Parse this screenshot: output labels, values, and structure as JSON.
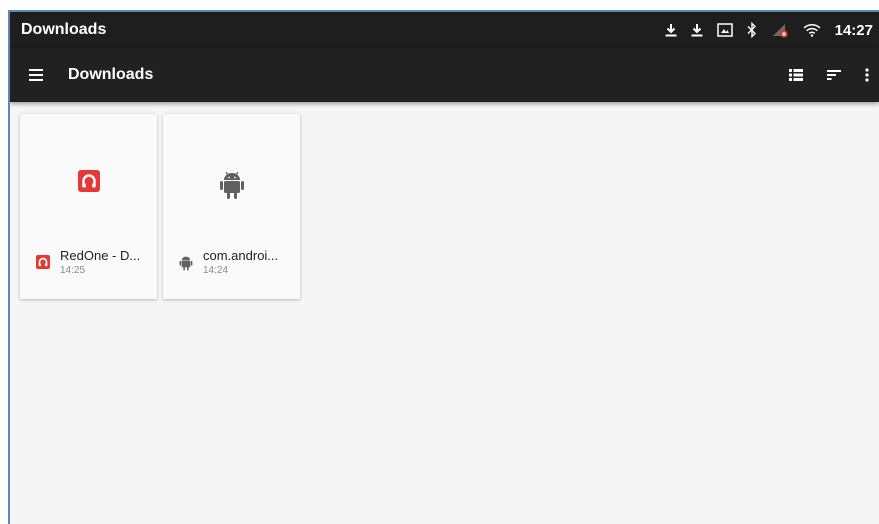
{
  "status_bar": {
    "title": "Downloads",
    "time": "14:27",
    "icons": [
      "download-icon",
      "download-icon",
      "screenshot-icon",
      "bluetooth-icon",
      "network-error-icon",
      "wifi-icon"
    ]
  },
  "toolbar": {
    "title": "Downloads",
    "menu_icon": "hamburger-menu-icon",
    "actions": [
      "list-view-icon",
      "sort-icon",
      "more-options-icon"
    ]
  },
  "files": [
    {
      "name": "RedOne - D...",
      "time": "14:25",
      "icon": "redone-app-icon",
      "color": "#e53935"
    },
    {
      "name": "com.androi...",
      "time": "14:24",
      "icon": "android-icon",
      "color": "#616161"
    }
  ],
  "colors": {
    "statusbar": "#1e1e1e",
    "toolbar": "#212121",
    "background": "#f5f5f5",
    "frame_border": "#5a88b8"
  }
}
